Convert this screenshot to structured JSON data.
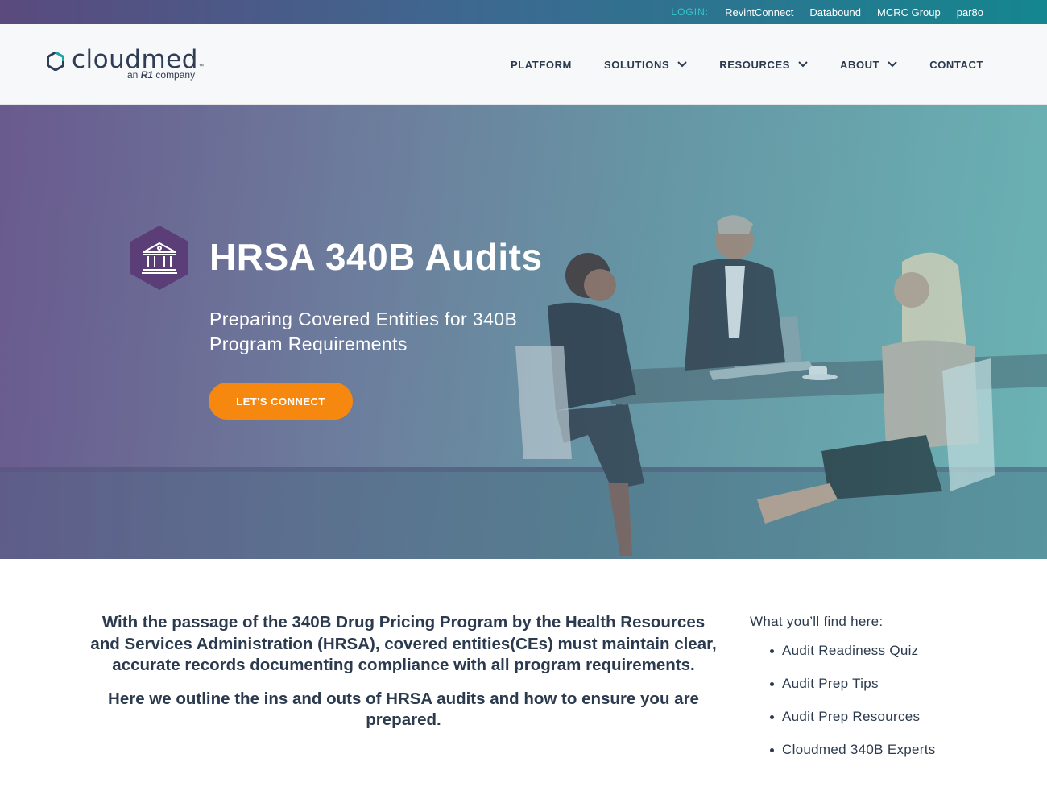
{
  "topbar": {
    "login_label": "LOGIN:",
    "links": [
      "RevintConnect",
      "Databound",
      "MCRC Group",
      "par8o"
    ]
  },
  "brand": {
    "name": "cloudmed",
    "tm": "™",
    "tagline_prefix": "an",
    "tagline_brand": "R1",
    "tagline_suffix": "company"
  },
  "nav": {
    "items": [
      {
        "label": "PLATFORM",
        "has_dropdown": false
      },
      {
        "label": "SOLUTIONS",
        "has_dropdown": true
      },
      {
        "label": "RESOURCES",
        "has_dropdown": true
      },
      {
        "label": "ABOUT",
        "has_dropdown": true
      },
      {
        "label": "CONTACT",
        "has_dropdown": false
      }
    ]
  },
  "hero": {
    "icon": "government-building-icon",
    "title": "HRSA 340B Audits",
    "subtitle": "Preparing Covered Entities for 340B Program Requirements",
    "cta_label": "LET'S CONNECT"
  },
  "intro": {
    "paragraph_1": "With the passage of the 340B Drug Pricing Program by the Health Resources and Services Administration (HRSA), covered entities(CEs) must maintain clear, accurate records documenting compliance with all program requirements.",
    "paragraph_2": "Here we outline the ins and outs of HRSA audits and how to ensure you are prepared."
  },
  "toc": {
    "heading": "What you’ll find here:",
    "items": [
      "Audit Readiness Quiz",
      "Audit Prep Tips",
      "Audit Prep Resources",
      "Cloudmed 340B Experts"
    ]
  },
  "colors": {
    "accent_orange": "#f7880f",
    "login_teal": "#38c8c9",
    "text_navy": "#2b3a4e",
    "hex_purple": "#5b3e78"
  }
}
